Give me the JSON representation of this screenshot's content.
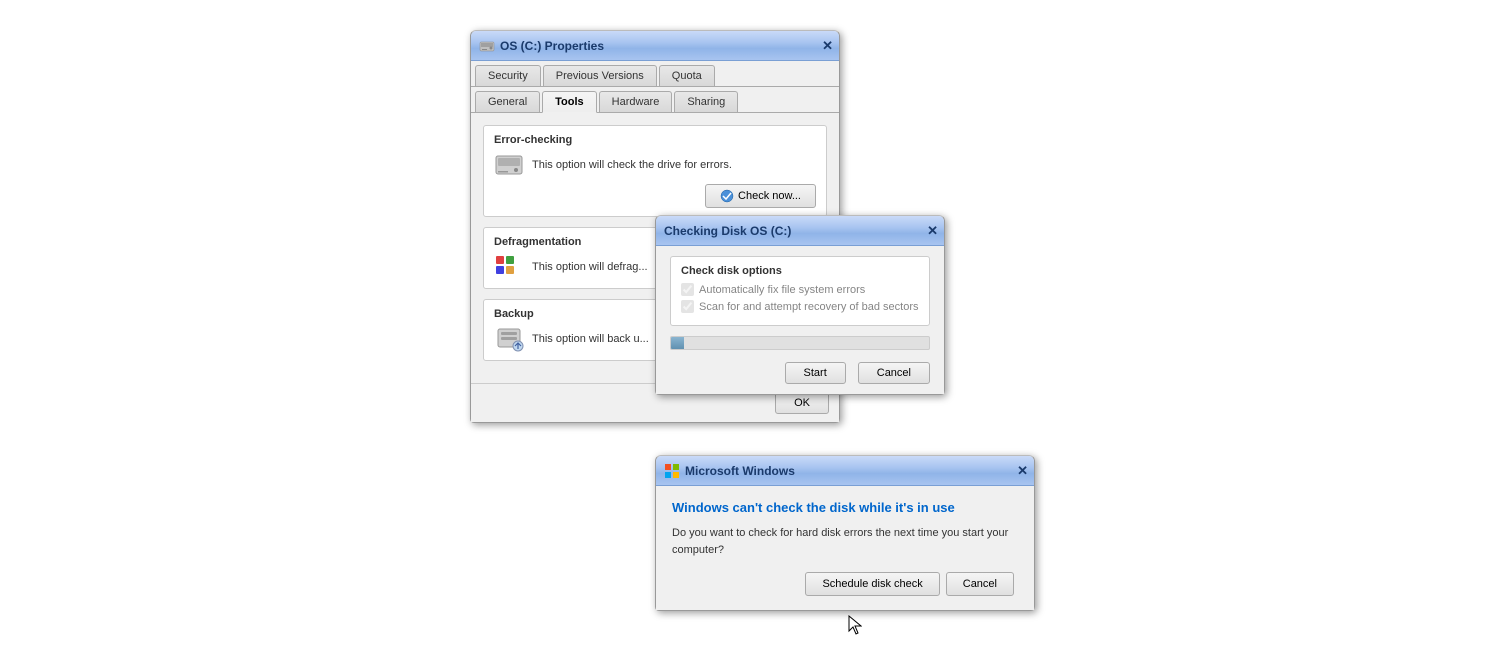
{
  "properties_dialog": {
    "title": "OS (C:) Properties",
    "tabs_row1": [
      {
        "label": "Security",
        "active": false
      },
      {
        "label": "Previous Versions",
        "active": false
      },
      {
        "label": "Quota",
        "active": false
      }
    ],
    "tabs_row2": [
      {
        "label": "General",
        "active": false
      },
      {
        "label": "Tools",
        "active": true
      },
      {
        "label": "Hardware",
        "active": false
      },
      {
        "label": "Sharing",
        "active": false
      }
    ],
    "error_checking": {
      "title": "Error-checking",
      "description": "This option will check the drive for errors.",
      "check_now_label": "Check now..."
    },
    "defragmentation": {
      "title": "Defragmentation",
      "description": "This option will defrag..."
    },
    "backup": {
      "title": "Backup",
      "description": "This option will back u..."
    },
    "ok_label": "OK"
  },
  "checkdisk_dialog": {
    "title": "Checking Disk OS (C:)",
    "group_title": "Check disk options",
    "option1": "Automatically fix file system errors",
    "option2": "Scan for and attempt recovery of bad sectors",
    "start_label": "Start",
    "cancel_label": "Cancel"
  },
  "mswindows_dialog": {
    "title": "Microsoft Windows",
    "warning_title": "Windows can't check the disk while it's in use",
    "warning_text": "Do you want to check for hard disk errors the next time you start your computer?",
    "schedule_label": "Schedule disk check",
    "cancel_label": "Cancel"
  }
}
